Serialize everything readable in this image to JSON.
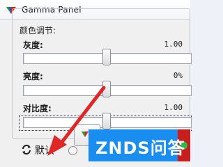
{
  "window": {
    "title": "Gamma Panel"
  },
  "group": {
    "label": "颜色调节:"
  },
  "rows": [
    {
      "label": "灰度:",
      "value": "1.00",
      "level": 0.5
    },
    {
      "label": "亮度:",
      "value": "0%",
      "level": 0.5
    },
    {
      "label": "对比度:",
      "value": "1.00",
      "level": 0.5
    }
  ],
  "buttons": {
    "default_label": "默认"
  },
  "watermark": {
    "text": "ZNDS问答"
  },
  "colors": {
    "arrow": "#e12626",
    "watermark_bg": "#1a8ef0",
    "watermark_accent": "#c81e1e"
  },
  "icons": {
    "app": "diamond-gamma-icon",
    "default": "refresh-icon",
    "info": "info-icon"
  }
}
